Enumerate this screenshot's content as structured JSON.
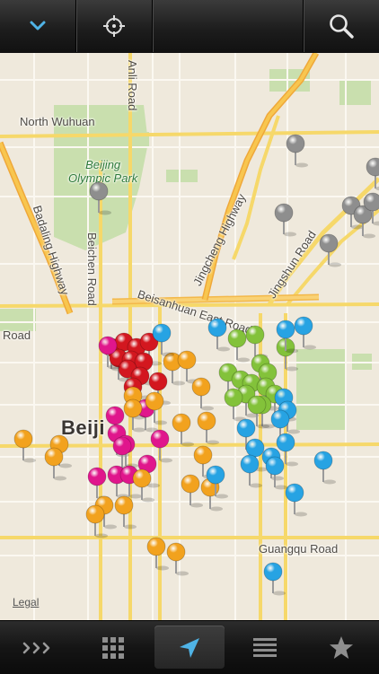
{
  "toolbar": {
    "left_icon": "chevron-down-icon",
    "center_icon": "crosshair-icon",
    "right_icon": "search-icon",
    "accent": "#4fb3e6"
  },
  "map": {
    "labels": {
      "north_wuhuan": "North Wuhuan",
      "anli_road": "Anli Road",
      "olympic_park": "Beijing\nOlympic Park",
      "badaling": "Badaling Highway",
      "beichen": "Beichen Road",
      "jingcheng": "Jingcheng Highway",
      "jingshun": "Jingshun Road",
      "beisanhuan": "Beisanhuan East Road",
      "road_left": "Road",
      "beijing": "Beiji",
      "guangqu": "Guangqu Road"
    },
    "legal": "Legal",
    "pin_colors": {
      "gray": "#8e8e8e",
      "red": "#d3171f",
      "magenta": "#e0168c",
      "orange": "#f2a21e",
      "green": "#83c23a",
      "blue": "#27a3e3"
    }
  },
  "tabbar": {
    "tabs": [
      {
        "icon": "more-icon"
      },
      {
        "icon": "grid-icon"
      },
      {
        "icon": "location-arrow-icon"
      },
      {
        "icon": "list-icon"
      },
      {
        "icon": "star-icon"
      }
    ],
    "active_index": 2
  }
}
